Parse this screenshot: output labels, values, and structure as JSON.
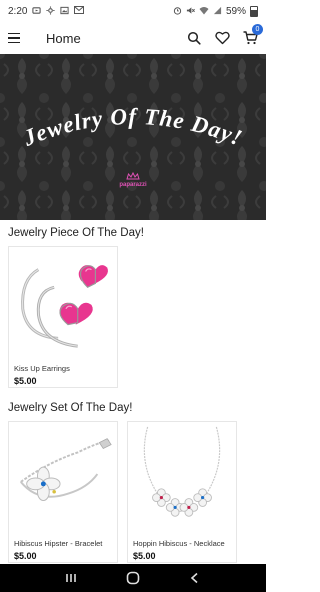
{
  "status_bar": {
    "time": "2:20",
    "battery_level": "59%"
  },
  "app_bar": {
    "title": "Home",
    "cart_count": "0"
  },
  "banner": {
    "headline": "Jewelry Of The Day!",
    "brand": "paparazzi"
  },
  "sections": [
    {
      "title": "Jewelry Piece Of The Day!",
      "products": [
        {
          "name": "Kiss Up Earrings",
          "price": "$5.00"
        }
      ]
    },
    {
      "title": "Jewelry Set Of The Day!",
      "products": [
        {
          "name": "Hibiscus Hipster - Bracelet",
          "price": "$5.00"
        },
        {
          "name": "Hoppin Hibiscus - Necklace",
          "price": "$5.00"
        }
      ]
    }
  ],
  "colors": {
    "accent": "#2a6ad8",
    "banner_bg": "#2b2b2b",
    "heart_pink": "#e8368f"
  }
}
